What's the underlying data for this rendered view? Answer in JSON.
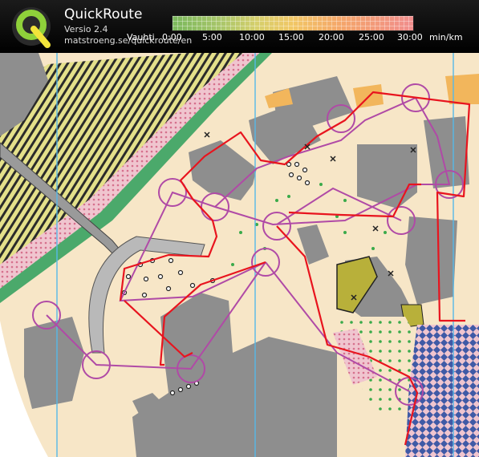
{
  "header": {
    "app_title": "QuickRoute",
    "version": "Versio 2.4",
    "url": "matstroeng.se/quickroute/en",
    "scale_prefix": "Vauhti",
    "scale_ticks": [
      "0:00",
      "5:00",
      "10:00",
      "15:00",
      "20:00",
      "25:00",
      "30:00"
    ],
    "scale_unit": "min/km"
  },
  "colors": {
    "course": "#b04aa6",
    "route": "#e8141e",
    "grid_line": "#55b8e8",
    "building": "#8e8e8e",
    "paved": "#f7e6c7",
    "vegetation": "#b8b03a",
    "railway_pink": "#e6a3b8",
    "water_cyan": "#4fb7e0"
  },
  "icons": {
    "logo": "quickroute-logo-icon"
  }
}
